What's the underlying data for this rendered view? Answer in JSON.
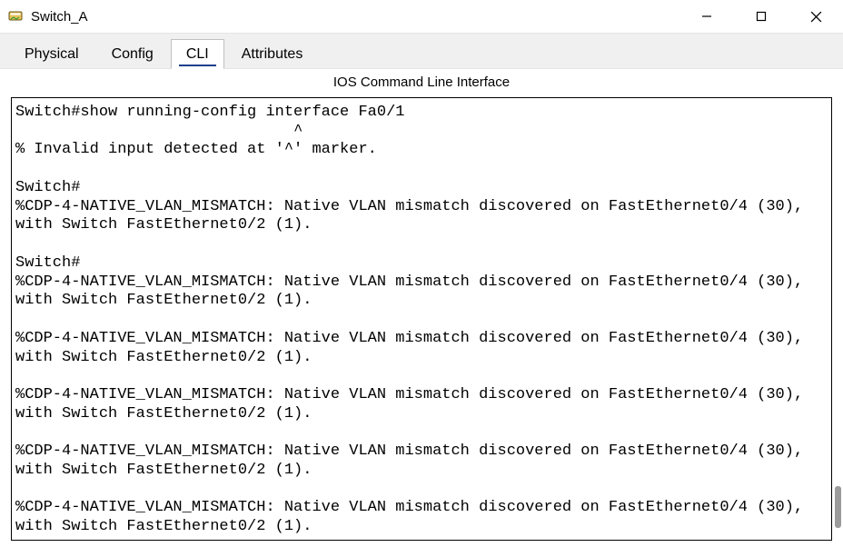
{
  "window": {
    "title": "Switch_A"
  },
  "tabs": {
    "physical": "Physical",
    "config": "Config",
    "cli": "CLI",
    "attributes": "Attributes"
  },
  "subtitle": "IOS Command Line Interface",
  "terminal_text": "Switch#show running-config interface Fa0/1\n                              ^\n% Invalid input detected at '^' marker.\n\t\nSwitch#\n%CDP-4-NATIVE_VLAN_MISMATCH: Native VLAN mismatch discovered on FastEthernet0/4 (30), with Switch FastEthernet0/2 (1).\n\nSwitch#\n%CDP-4-NATIVE_VLAN_MISMATCH: Native VLAN mismatch discovered on FastEthernet0/4 (30), with Switch FastEthernet0/2 (1).\n\n%CDP-4-NATIVE_VLAN_MISMATCH: Native VLAN mismatch discovered on FastEthernet0/4 (30), with Switch FastEthernet0/2 (1).\n\n%CDP-4-NATIVE_VLAN_MISMATCH: Native VLAN mismatch discovered on FastEthernet0/4 (30), with Switch FastEthernet0/2 (1).\n\n%CDP-4-NATIVE_VLAN_MISMATCH: Native VLAN mismatch discovered on FastEthernet0/4 (30), with Switch FastEthernet0/2 (1).\n\n%CDP-4-NATIVE_VLAN_MISMATCH: Native VLAN mismatch discovered on FastEthernet0/4 (30), with Switch FastEthernet0/2 (1).\n"
}
